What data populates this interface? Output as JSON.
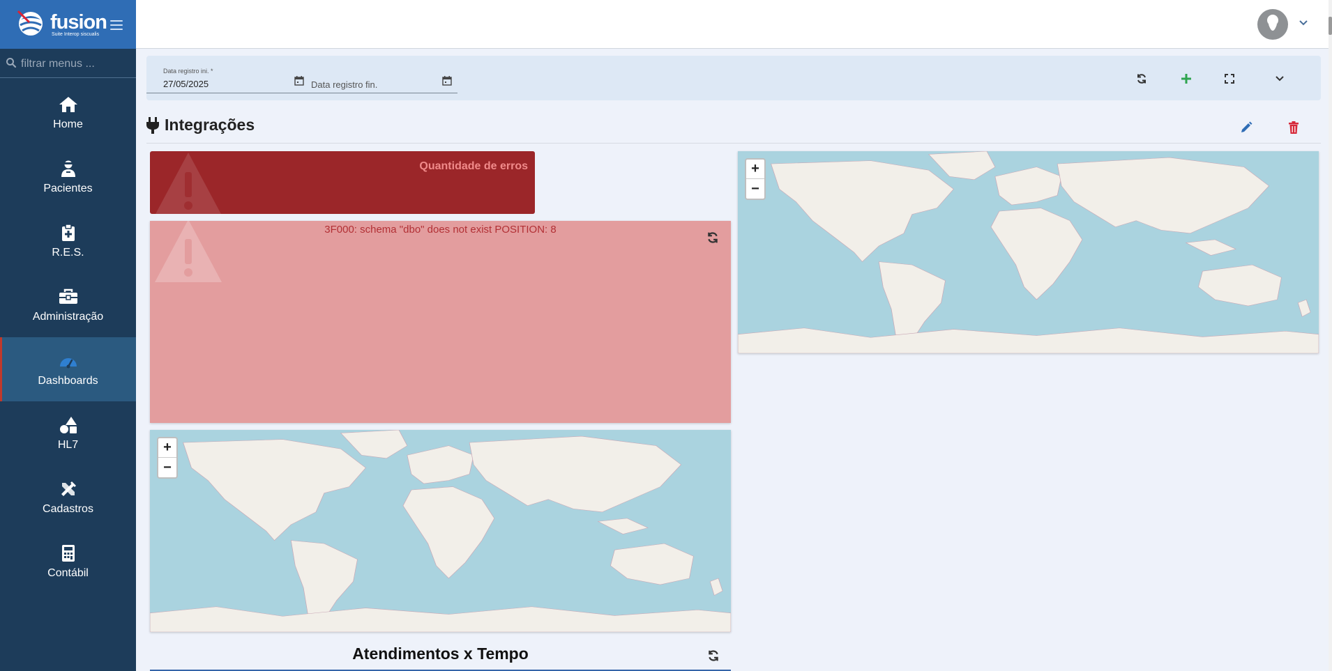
{
  "brand": {
    "name": "fusion",
    "subtitle": "Suite Interop siscualis"
  },
  "sidebar": {
    "search_placeholder": "filtrar menus ...",
    "items": [
      {
        "label": "Home",
        "icon": "home-icon"
      },
      {
        "label": "Pacientes",
        "icon": "patient-icon"
      },
      {
        "label": "R.E.S.",
        "icon": "clipboard-medical-icon"
      },
      {
        "label": "Administração",
        "icon": "toolbox-icon"
      },
      {
        "label": "Dashboards",
        "icon": "gauge-icon",
        "active": true
      },
      {
        "label": "HL7",
        "icon": "shapes-icon"
      },
      {
        "label": "Cadastros",
        "icon": "tools-icon"
      },
      {
        "label": "Contábil",
        "icon": "calculator-icon"
      }
    ]
  },
  "filters": {
    "start_label": "Data registro ini. *",
    "start_value": "27/05/2025",
    "end_placeholder": "Data registro fin."
  },
  "section": {
    "title": "Integrações"
  },
  "widgets": {
    "error_count_title": "Quantidade de erros",
    "error_message": "3F000: schema \"dbo\" does not exist POSITION: 8",
    "chart_title": "Atendimentos x Tempo"
  },
  "map_controls": {
    "zoom_in": "+",
    "zoom_out": "−"
  },
  "colors": {
    "sidebar": "#1d3c5a",
    "logo_bar": "#2f6db5",
    "error_dark": "#9b2629",
    "error_light": "#e39d9e",
    "ocean": "#aad3df",
    "land": "#f2efe9"
  }
}
